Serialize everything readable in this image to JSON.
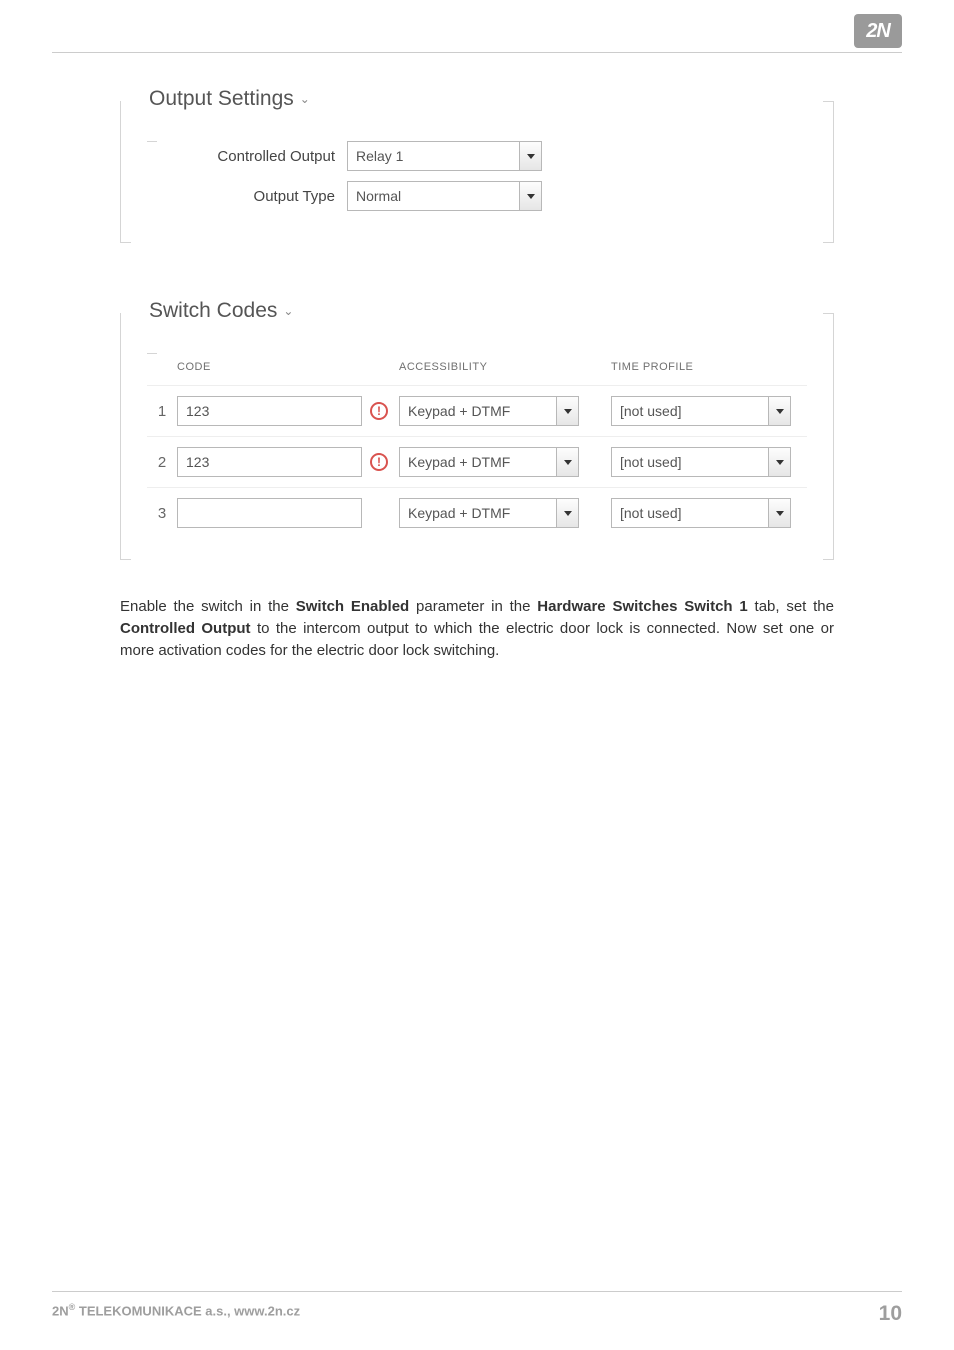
{
  "logo_text": "2N",
  "sections": {
    "output": {
      "title": "Output Settings",
      "rows": {
        "controlled_output": {
          "label": "Controlled Output",
          "value": "Relay 1"
        },
        "output_type": {
          "label": "Output Type",
          "value": "Normal"
        }
      }
    },
    "codes": {
      "title": "Switch Codes",
      "headers": {
        "code": "CODE",
        "accessibility": "ACCESSIBILITY",
        "time_profile": "TIME PROFILE"
      },
      "rows": [
        {
          "idx": "1",
          "code": "123",
          "warn": true,
          "accessibility": "Keypad + DTMF",
          "time_profile": "[not used]"
        },
        {
          "idx": "2",
          "code": "123",
          "warn": true,
          "accessibility": "Keypad + DTMF",
          "time_profile": "[not used]"
        },
        {
          "idx": "3",
          "code": "",
          "warn": false,
          "accessibility": "Keypad + DTMF",
          "time_profile": "[not used]"
        }
      ]
    }
  },
  "paragraph": {
    "p1a": "Enable the switch in the ",
    "b1": "Switch Enabled",
    "p1b": " parameter in the ",
    "b2": "Hardware  Switches  Switch 1",
    "p1c": " tab, set the ",
    "b3": "Controlled Output",
    "p1d": " to the intercom output to which the electric door lock is connected. Now set one or more activation codes for the electric door lock switching."
  },
  "footer": {
    "company": "2N",
    "reg": "®",
    "rest": " TELEKOMUNIKACE a.s., www.2n.cz",
    "page": "10"
  }
}
